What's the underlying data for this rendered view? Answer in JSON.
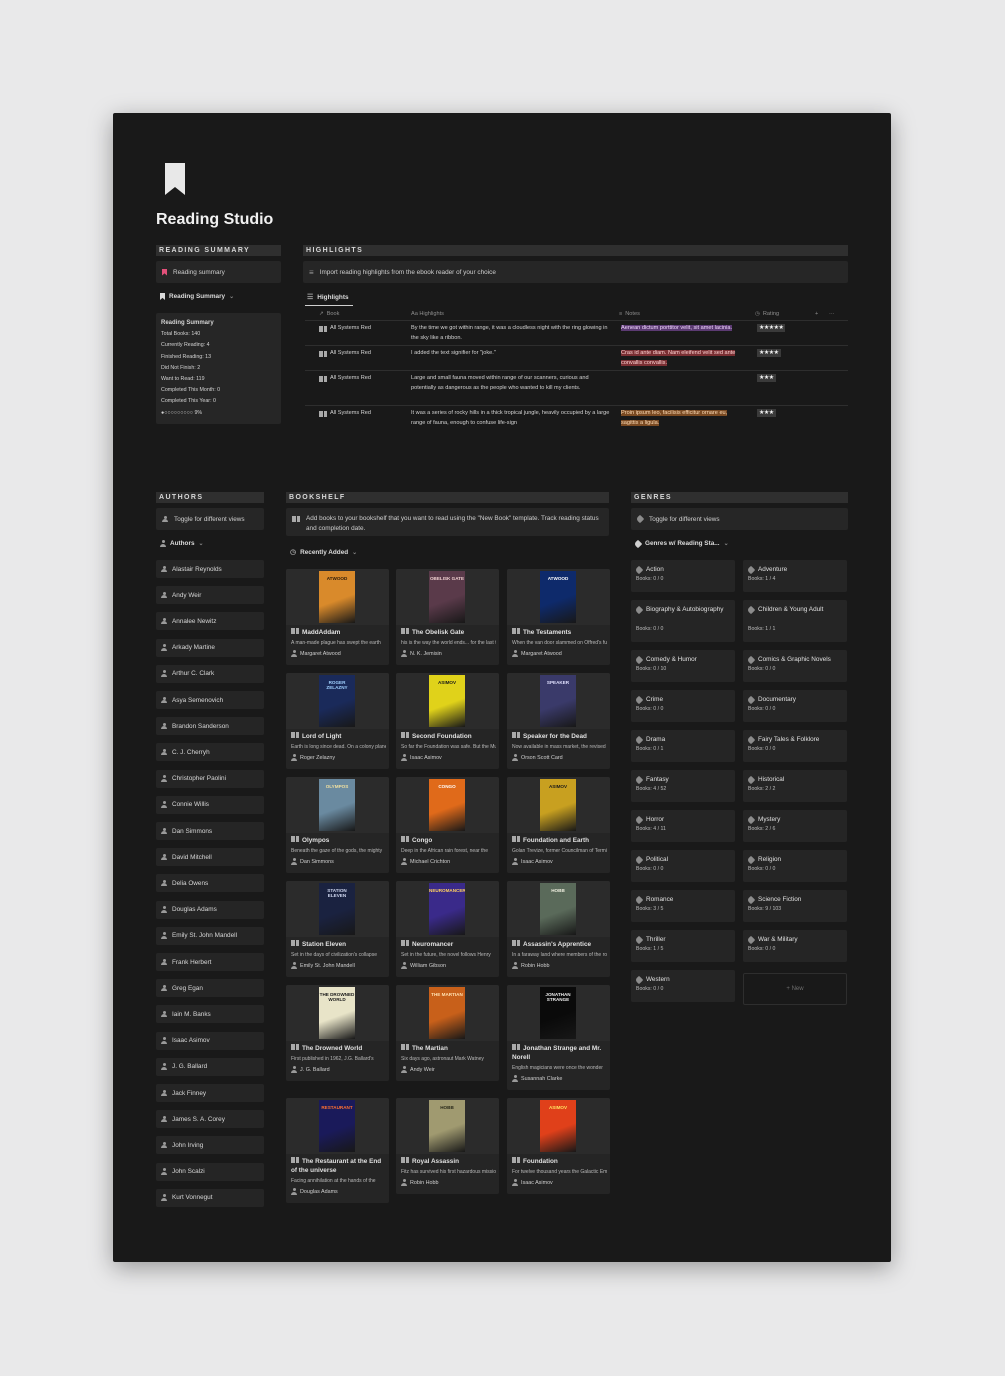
{
  "page": {
    "title": "Reading Studio"
  },
  "reading_summary": {
    "section_label": "READING SUMMARY",
    "callout": "Reading summary",
    "view_label": "Reading Summary",
    "card": {
      "title": "Reading Summary",
      "lines": [
        "Total Books: 140",
        "Currently Reading: 4",
        "Finished Reading: 13",
        "Did Not Finish: 2",
        "Want to Read: 119",
        "Completed This Month: 0",
        "Completed This Year: 0"
      ],
      "progress_text": "●○○○○○○○○○ 9%",
      "progress_fraction": 0.09
    }
  },
  "highlights": {
    "section_label": "HIGHLIGHTS",
    "callout": "Import reading highlights from the ebook reader of your choice",
    "view_label": "Highlights",
    "columns": {
      "book": "Book",
      "highlights": "Aa Highlights",
      "notes": "Notes",
      "rating": "Rating",
      "add": "+",
      "more": "···"
    },
    "rows": [
      {
        "book": "All Systems Red",
        "highlight": "By the time we got within range, it was a cloudless night with the ring glowing in the sky like a ribbon.",
        "note": "Aenean dictum porttitor velit, sit amet lacinia.",
        "note_color": "purple",
        "rating": "★★★★★"
      },
      {
        "book": "All Systems Red",
        "highlight": "I added the text signifier for \"joke.\"",
        "note": "Cras id ante diam. Nam eleifend velit sed ante convallis convallis.",
        "note_color": "red",
        "rating": "★★★★"
      },
      {
        "book": "All Systems Red",
        "highlight": "Large and small fauna moved within range of our scanners, curious and potentially as dangerous as the people who wanted to kill my clients.",
        "note": "",
        "note_color": "",
        "rating": "★★★"
      },
      {
        "book": "All Systems Red",
        "highlight": "It was a series of rocky hills in a thick tropical jungle, heavily occupied by a large range of fauna, enough to confuse life-sign",
        "note": "Proin ipsum leo, facilisis efficitur ornare eu, sagittis a ligula.",
        "note_color": "orange",
        "rating": "★★★"
      }
    ]
  },
  "authors": {
    "section_label": "AUTHORS",
    "callout": "Toggle for different views",
    "view_label": "Authors",
    "items": [
      "Alastair Reynolds",
      "Andy Weir",
      "Annalee Newitz",
      "Arkady Martine",
      "Arthur C. Clark",
      "Asya Semenovich",
      "Brandon Sanderson",
      "C. J. Cherryh",
      "Christopher Paolini",
      "Connie Willis",
      "Dan Simmons",
      "David Mitchell",
      "Delia Owens",
      "Douglas Adams",
      "Emily St. John Mandell",
      "Frank Herbert",
      "Greg Egan",
      "Iain M. Banks",
      "Isaac Asimov",
      "J. G. Ballard",
      "Jack Finney",
      "James S. A. Corey",
      "John Irving",
      "John Scalzi",
      "Kurt Vonnegut"
    ]
  },
  "bookshelf": {
    "section_label": "BOOKSHELF",
    "callout": "Add books to your bookshelf that you want to read using the \"New Book\" template. Track reading status and completion date.",
    "view_label": "Recently Added",
    "books": [
      {
        "title": "MaddAddam",
        "desc": "A man-made plague has swept the earth",
        "author": "Margaret Atwood",
        "cover_text": "ATWOOD",
        "cover_bg": "#d98a2b",
        "cover_fg": "#2a1a0a"
      },
      {
        "title": "The Obelisk Gate",
        "desc": "his is the way the world ends... for the last time",
        "author": "N. K. Jemisin",
        "cover_text": "OBELISK GATE",
        "cover_bg": "#5a3a4a",
        "cover_fg": "#f0d0d0"
      },
      {
        "title": "The Testaments",
        "desc": "When the van door slammed on Offred's future",
        "author": "Margaret Atwood",
        "cover_text": "ATWOOD",
        "cover_bg": "#0e2a6b",
        "cover_fg": "#ffffff"
      },
      {
        "title": "Lord of Light",
        "desc": "Earth is long since dead. On a colony planet",
        "author": "Roger Zelazny",
        "cover_text": "ROGER ZELAZNY",
        "cover_bg": "#1a2a5a",
        "cover_fg": "#9fd0ff"
      },
      {
        "title": "Second Foundation",
        "desc": "So far the Foundation was safe. But the Mule",
        "author": "Isaac Asimov",
        "cover_text": "ASIMOV",
        "cover_bg": "#e0d21a",
        "cover_fg": "#1a1a1a"
      },
      {
        "title": "Speaker for the Dead",
        "desc": "Now available in mass market, the revised",
        "author": "Orson Scott Card",
        "cover_text": "SPEAKER",
        "cover_bg": "#3a3a6a",
        "cover_fg": "#e0e0ff"
      },
      {
        "title": "Olympos",
        "desc": "Beneath the gaze of the gods, the mighty",
        "author": "Dan Simmons",
        "cover_text": "OLYMPOS",
        "cover_bg": "#6a8aa0",
        "cover_fg": "#f0e0a0"
      },
      {
        "title": "Congo",
        "desc": "Deep in the African rain forest, near the",
        "author": "Michael Crichton",
        "cover_text": "CONGO",
        "cover_bg": "#e06a1a",
        "cover_fg": "#ffffff"
      },
      {
        "title": "Foundation and Earth",
        "desc": "Golan Trevize, former Councilman of Terminus",
        "author": "Isaac Asimov",
        "cover_text": "ASIMOV",
        "cover_bg": "#c8a020",
        "cover_fg": "#1a1a1a"
      },
      {
        "title": "Station Eleven",
        "desc": "Set in the days of civilization's collapse",
        "author": "Emily St. John Mandell",
        "cover_text": "STATION ELEVEN",
        "cover_bg": "#1a2240",
        "cover_fg": "#d0d8f0"
      },
      {
        "title": "Neuromancer",
        "desc": "Set in the future, the novel follows Henry",
        "author": "William Gibson",
        "cover_text": "NEUROMANCER",
        "cover_bg": "#3a2a8a",
        "cover_fg": "#ffd060"
      },
      {
        "title": "Assassin's Apprentice",
        "desc": "In a faraway land where members of the royal",
        "author": "Robin Hobb",
        "cover_text": "HOBB",
        "cover_bg": "#5a6a5a",
        "cover_fg": "#f0f0e0"
      },
      {
        "title": "The Drowned World",
        "desc": "First published in 1962, J.G. Ballard's",
        "author": "J. G. Ballard",
        "cover_text": "THE DROWNED WORLD",
        "cover_bg": "#e8e4c8",
        "cover_fg": "#1a1a1a"
      },
      {
        "title": "The Martian",
        "desc": "Six days ago, astronaut Mark Watney",
        "author": "Andy Weir",
        "cover_text": "THE MARTIAN",
        "cover_bg": "#c8601a",
        "cover_fg": "#ffe0b0"
      },
      {
        "title": "Jonathan Strange and Mr. Norell",
        "desc": "English magicians were once the wonder",
        "author": "Susannah Clarke",
        "cover_text": "JONATHAN STRANGE",
        "cover_bg": "#0a0a0a",
        "cover_fg": "#f0f0f0"
      },
      {
        "title": "The Restaurant at the End of the universe",
        "desc": "Facing annihilation at the hands of the",
        "author": "Douglas Adams",
        "cover_text": "RESTAURANT",
        "cover_bg": "#1a1a5a",
        "cover_fg": "#ff7030"
      },
      {
        "title": "Royal Assassin",
        "desc": "Fitz has survived his first hazardous mission",
        "author": "Robin Hobb",
        "cover_text": "HOBB",
        "cover_bg": "#a09a70",
        "cover_fg": "#2a2a1a"
      },
      {
        "title": "Foundation",
        "desc": "For twelve thousand years the Galactic Empire",
        "author": "Isaac Asimov",
        "cover_text": "ASIMOV",
        "cover_bg": "#e0401a",
        "cover_fg": "#ffe060"
      }
    ]
  },
  "genres": {
    "section_label": "GENRES",
    "callout": "Toggle for different views",
    "view_label": "Genres w/ Reading Sta...",
    "items": [
      {
        "name": "Action",
        "count": "Books: 0 / 0"
      },
      {
        "name": "Adventure",
        "count": "Books: 1 / 4"
      },
      {
        "name": "Biography & Autobiography",
        "count": "Books: 0 / 0"
      },
      {
        "name": "Children & Young Adult",
        "count": "Books: 1 / 1"
      },
      {
        "name": "Comedy & Humor",
        "count": "Books: 0 / 10"
      },
      {
        "name": "Comics & Graphic Novels",
        "count": "Books: 0 / 0"
      },
      {
        "name": "Crime",
        "count": "Books: 0 / 0"
      },
      {
        "name": "Documentary",
        "count": "Books: 0 / 0"
      },
      {
        "name": "Drama",
        "count": "Books: 0 / 1"
      },
      {
        "name": "Fairy Tales & Folklore",
        "count": "Books: 0 / 0"
      },
      {
        "name": "Fantasy",
        "count": "Books: 4 / 52"
      },
      {
        "name": "Historical",
        "count": "Books: 2 / 2"
      },
      {
        "name": "Horror",
        "count": "Books: 4 / 11"
      },
      {
        "name": "Mystery",
        "count": "Books: 2 / 6"
      },
      {
        "name": "Political",
        "count": "Books: 0 / 0"
      },
      {
        "name": "Religion",
        "count": "Books: 0 / 0"
      },
      {
        "name": "Romance",
        "count": "Books: 3 / 5"
      },
      {
        "name": "Science Fiction",
        "count": "Books: 9 / 103"
      },
      {
        "name": "Thriller",
        "count": "Books: 1 / 5"
      },
      {
        "name": "War & Military",
        "count": "Books: 0 / 0"
      },
      {
        "name": "Western",
        "count": "Books: 0 / 0"
      }
    ],
    "new_label": "+ New"
  }
}
